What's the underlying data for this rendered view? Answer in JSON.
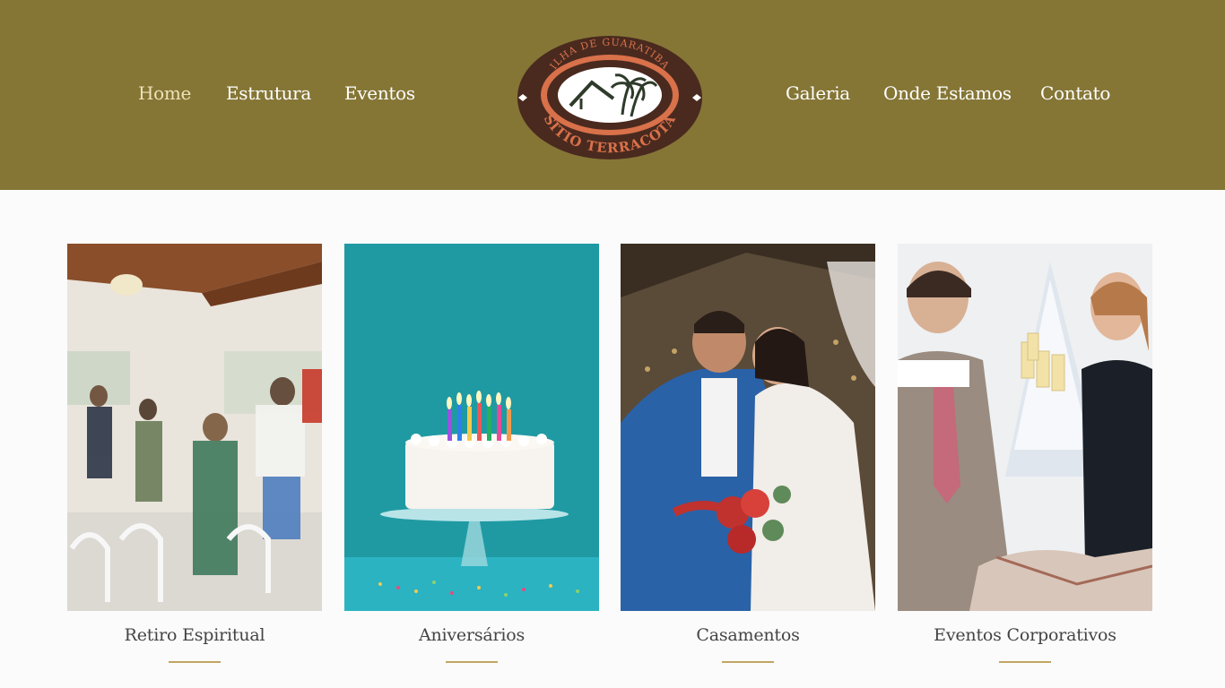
{
  "nav": {
    "left": [
      {
        "label": "Home",
        "active": true
      },
      {
        "label": "Estrutura"
      },
      {
        "label": "Eventos"
      }
    ],
    "right": [
      {
        "label": "Galeria"
      },
      {
        "label": "Onde Estamos"
      },
      {
        "label": "Contato"
      }
    ]
  },
  "logo": {
    "top_text": "ILHA DE GUARATIBA",
    "bottom_text": "SÍTIO TERRACOTA"
  },
  "cards": [
    {
      "title": "Retiro Espiritual"
    },
    {
      "title": "Aniversários"
    },
    {
      "title": "Casamentos"
    },
    {
      "title": "Eventos Corporativos"
    }
  ],
  "colors": {
    "header_bg": "#857636",
    "accent_rule": "#c0a661",
    "logo_brown": "#4a2a1f",
    "logo_terracotta": "#d9714a"
  }
}
